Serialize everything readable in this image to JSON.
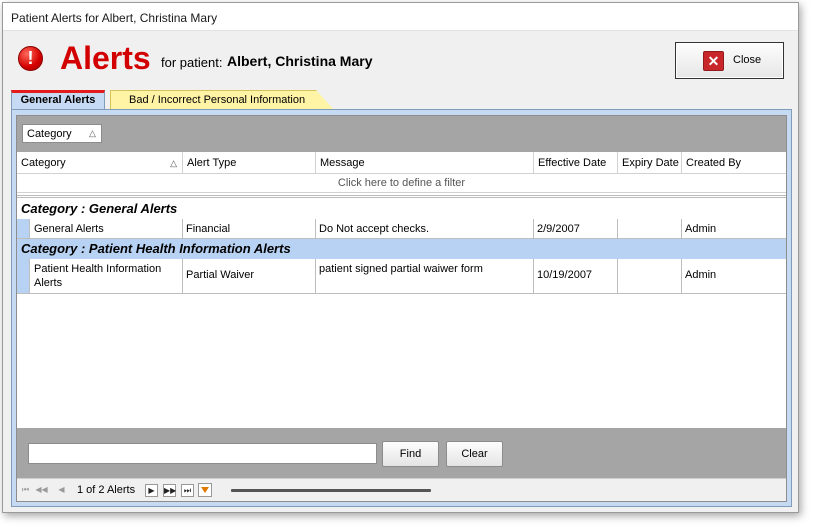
{
  "window": {
    "title": "Patient Alerts for Albert, Christina Mary"
  },
  "header": {
    "alert_icon_glyph": "!",
    "title": "Alerts",
    "for_patient_label": "for patient:",
    "patient_name": "Albert, Christina Mary",
    "close_glyph": "✕",
    "close_label": "Close"
  },
  "tabs": [
    {
      "label": "General Alerts",
      "active": true
    },
    {
      "label": "Bad / Incorrect Personal Information",
      "active": false
    }
  ],
  "grid": {
    "group_by_chip": "Category",
    "sort_asc_glyph": "△",
    "columns": [
      "Category",
      "Alert Type",
      "Message",
      "Effective Date",
      "Expiry Date",
      "Created By"
    ],
    "filter_prompt": "Click here to define a filter",
    "groups": [
      {
        "header": "Category : General Alerts",
        "rows": [
          {
            "category": "General Alerts",
            "alert_type": "Financial",
            "message": "Do Not accept checks.",
            "effective_date": "2/9/2007",
            "expiry_date": "",
            "created_by": "Admin"
          }
        ]
      },
      {
        "header": "Category : Patient Health Information Alerts",
        "rows": [
          {
            "category": "Patient Health Information Alerts",
            "alert_type": "Partial Waiver",
            "message": "patient signed partial waiwer form",
            "effective_date": "10/19/2007",
            "expiry_date": "",
            "created_by": "Admin"
          }
        ]
      }
    ]
  },
  "footer": {
    "search_value": "",
    "find_label": "Find",
    "clear_label": "Clear"
  },
  "navigator": {
    "first_glyph": "⏮",
    "prev_page_glyph": "◀◀",
    "prev_glyph": "◀",
    "status": "1 of 2 Alerts",
    "next_glyph": "▶",
    "next_page_glyph": "▶▶",
    "last_glyph": "⏭"
  },
  "colors": {
    "accent_red": "#d20000",
    "tab_blue": "#c6daf3",
    "tab_yellow": "#fff4a6",
    "group_blue": "#b7d2f3"
  }
}
